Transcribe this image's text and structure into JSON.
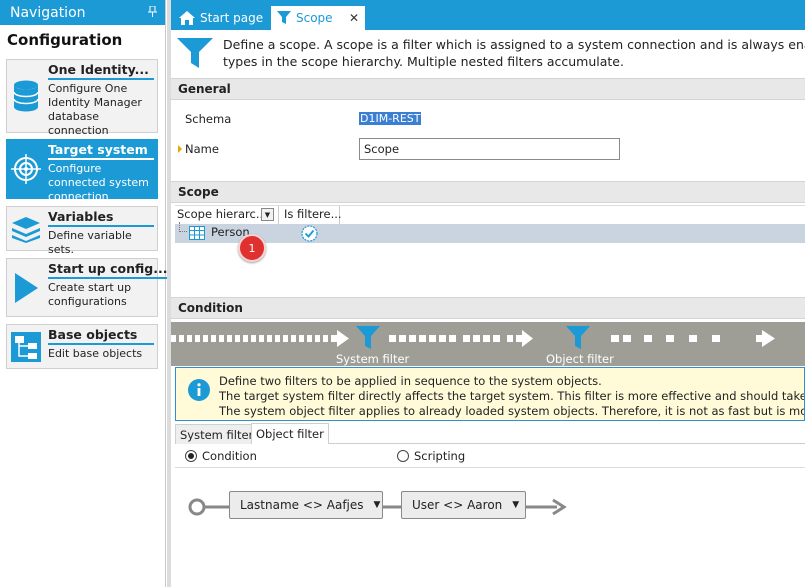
{
  "nav": {
    "title": "Navigation",
    "pin_glyph": "ꟷ",
    "section": "Configuration",
    "items": [
      {
        "title": "One Identity...",
        "desc": "Configure One Identity Manager database connection",
        "icon": "database-icon"
      },
      {
        "title": "Target system",
        "desc": "Configure connected system connection",
        "icon": "target-icon"
      },
      {
        "title": "Variables",
        "desc": "Define variable sets.",
        "icon": "stack-icon"
      },
      {
        "title": "Start up config...",
        "desc": "Create start up configurations",
        "icon": "play-icon"
      },
      {
        "title": "Base objects",
        "desc": "Edit base objects",
        "icon": "hierarchy-icon"
      }
    ]
  },
  "tabs": {
    "start": "Start page",
    "scope": "Scope",
    "close": "✕"
  },
  "description": {
    "line1": "Define a scope. A scope is a filter which is assigned to a system connection and is always enable",
    "line2": "types in the scope hierarchy. Multiple nested filters accumulate."
  },
  "general": {
    "header": "General",
    "schema_label": "Schema",
    "schema_value": "D1IM-REST",
    "name_label": "Name",
    "name_value": "Scope"
  },
  "scope": {
    "header": "Scope",
    "col1": "Scope hierarc...",
    "col2": "Is filtere...",
    "row_label": "Person",
    "badge": "1"
  },
  "condition": {
    "header": "Condition",
    "system_filter": "System filter",
    "object_filter": "Object filter",
    "info_line1": "Define two filters to be applied in sequence to the system objects.",
    "info_line2": "The target system filter directly affects the target system. This filter is more effective and should take precedenc",
    "info_line3": "The system object filter applies to already loaded system objects. Therefore, it is not as fast but is more flexible t",
    "subtab_system": "System filter",
    "subtab_object": "Object filter",
    "radio_condition": "Condition",
    "radio_scripting": "Scripting",
    "chip1": "Lastname  <>  Aafjes",
    "chip2": "User  <>  Aaron"
  },
  "colors": {
    "accent": "#1b9ad6",
    "pipeline": "#9e9e97",
    "badge": "#e03131",
    "info_bg": "#fffbd9"
  }
}
